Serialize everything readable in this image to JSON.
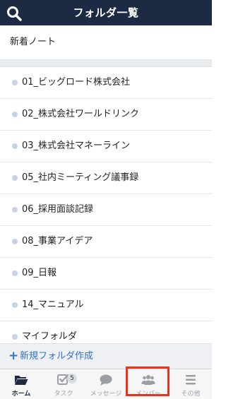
{
  "header": {
    "title": "フォルダ一覧",
    "search_icon": "search-icon"
  },
  "recent": {
    "label": "新着ノート"
  },
  "folders": [
    "01_ビッグロード株式会社",
    "02_株式会社ワールドリンク",
    "03_株式会社マネーライン",
    "05_社内ミーティング議事録",
    "06_採用面談記録",
    "08_事業アイデア",
    "09_日報",
    "14_マニュアル",
    "マイフォルダ"
  ],
  "new_folder": {
    "plus": "+",
    "label": "新規フォルダ作成"
  },
  "tabs": [
    {
      "label": "ホーム",
      "icon": "folder-open-icon"
    },
    {
      "label": "タスク",
      "icon": "checkbox-icon",
      "badge": "5"
    },
    {
      "label": "メッセージ",
      "icon": "chat-bubble-icon"
    },
    {
      "label": "メンバー",
      "icon": "members-icon"
    },
    {
      "label": "その他",
      "icon": "menu-icon"
    }
  ],
  "colors": {
    "header_bg": "#1c2a44",
    "accent": "#2f73c9",
    "bullet": "#c5d3ea",
    "highlight": "#e8331f"
  }
}
